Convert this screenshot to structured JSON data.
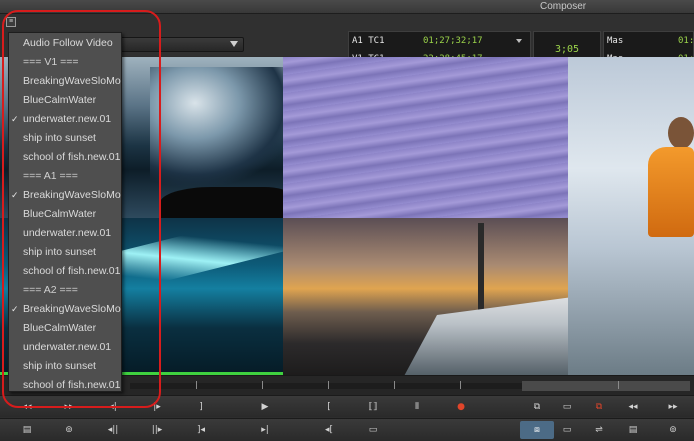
{
  "window": {
    "title": "Composer"
  },
  "top": {
    "small_icon_glyph": "≡",
    "timecode_left": [
      {
        "label": "A1 TC1",
        "value": "01;27;32;17"
      },
      {
        "label": "V1 TC1",
        "value": "22;28;45;17"
      }
    ],
    "center_duration": "3;05",
    "timecode_right": [
      {
        "label": "Mas",
        "value": "01:"
      },
      {
        "label": "Mas",
        "value": "01:"
      }
    ]
  },
  "menu": {
    "items": [
      {
        "label": "Audio Follow Video",
        "checked": false,
        "header": false
      },
      {
        "label": "=== V1 ===",
        "checked": false,
        "header": true
      },
      {
        "label": "BreakingWaveSloMo",
        "checked": false,
        "header": false
      },
      {
        "label": "BlueCalmWater",
        "checked": false,
        "header": false
      },
      {
        "label": "underwater.new.01",
        "checked": true,
        "header": false
      },
      {
        "label": "ship into sunset",
        "checked": false,
        "header": false
      },
      {
        "label": "school of fish.new.01",
        "checked": false,
        "header": false
      },
      {
        "label": "=== A1 ===",
        "checked": false,
        "header": true
      },
      {
        "label": "BreakingWaveSloMo",
        "checked": true,
        "header": false
      },
      {
        "label": "BlueCalmWater",
        "checked": false,
        "header": false
      },
      {
        "label": "underwater.new.01",
        "checked": false,
        "header": false
      },
      {
        "label": "ship into sunset",
        "checked": false,
        "header": false
      },
      {
        "label": "school of fish.new.01",
        "checked": false,
        "header": false
      },
      {
        "label": "=== A2 ===",
        "checked": false,
        "header": true
      },
      {
        "label": "BreakingWaveSloMo",
        "checked": true,
        "header": false
      },
      {
        "label": "BlueCalmWater",
        "checked": false,
        "header": false
      },
      {
        "label": "underwater.new.01",
        "checked": false,
        "header": false
      },
      {
        "label": "ship into sunset",
        "checked": false,
        "header": false
      },
      {
        "label": "school of fish.new.01",
        "checked": false,
        "header": false
      }
    ],
    "check_glyph": "✓"
  },
  "toolbar": {
    "row1": [
      "◂◂",
      "▸▸",
      "◂|",
      "|▸",
      "]",
      "▶",
      "[",
      "⟦⟧",
      "⫴",
      "●",
      "⧉",
      "▭",
      "⧉",
      "◂◂",
      "▸▸"
    ],
    "row2": [
      "▤",
      "⊚",
      "◂||",
      "||▸",
      "]◂",
      "▸|",
      "◂[",
      "▭",
      "",
      "",
      "⧈",
      "▭",
      "⇌",
      "▤",
      "⊚"
    ]
  },
  "colors": {
    "accent_green": "#9bd34a",
    "highlight_red": "#d71c1c",
    "record_red": "#e0452a"
  }
}
